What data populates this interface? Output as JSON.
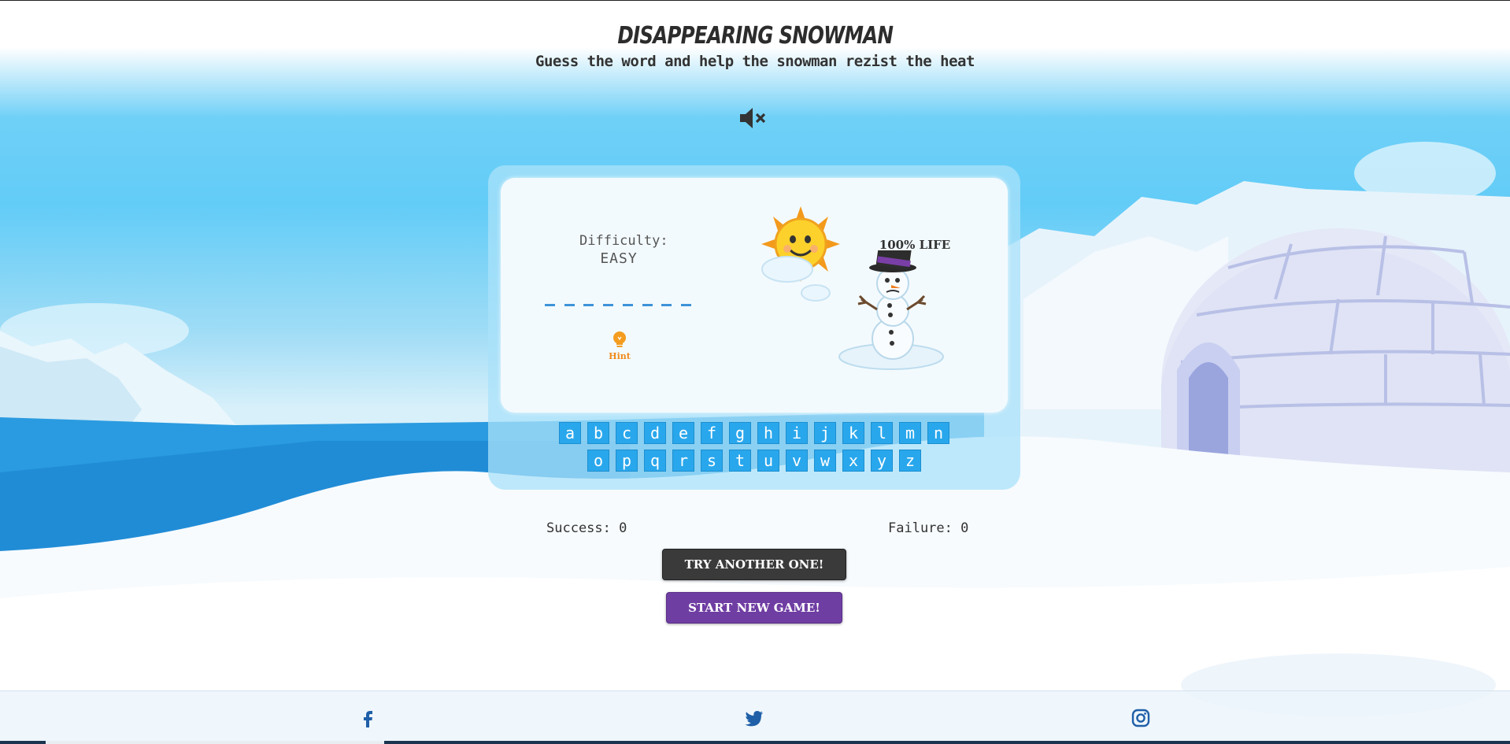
{
  "header": {
    "title": "DISAPPEARING SNOWMAN",
    "subtitle": "Guess the word and help the snowman rezist the heat"
  },
  "sound": {
    "icon": "speaker-muted-icon",
    "muted": true
  },
  "game": {
    "difficulty_label": "Difficulty:",
    "difficulty_value": "EASY",
    "word_length": 8,
    "hint_label": "Hint",
    "life_label": "100% LIFE",
    "life_percent": 100
  },
  "keyboard": {
    "row1": [
      "a",
      "b",
      "c",
      "d",
      "e",
      "f",
      "g",
      "h",
      "i",
      "j",
      "k",
      "l",
      "m",
      "n"
    ],
    "row2": [
      "o",
      "p",
      "q",
      "r",
      "s",
      "t",
      "u",
      "v",
      "w",
      "x",
      "y",
      "z"
    ]
  },
  "score": {
    "success_label": "Success: 0",
    "failure_label": "Failure: 0"
  },
  "buttons": {
    "try_another": "TRY ANOTHER ONE!",
    "start_new": "START NEW GAME!"
  },
  "footer": {
    "icons": [
      "facebook-icon",
      "twitter-icon",
      "instagram-icon"
    ]
  },
  "colors": {
    "key": "#29a7ec",
    "dash": "#3d93d8",
    "hint": "#f08a1a",
    "try_button": "#3a3a3a",
    "new_game_button": "#6f3ea3"
  }
}
